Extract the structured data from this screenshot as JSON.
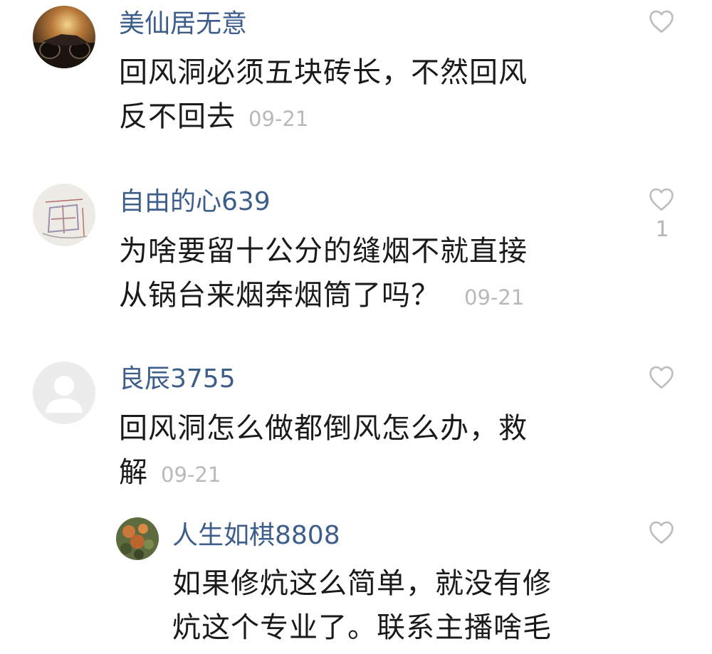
{
  "comments": [
    {
      "username": "美仙居无意",
      "lines": [
        "回风洞必须五块砖长，不然回风",
        "反不回去"
      ],
      "time": "09-21",
      "likes": ""
    },
    {
      "username": "自由的心639",
      "lines": [
        "为啥要留十公分的缝烟不就直接",
        "从锅台来烟奔烟筒了吗？"
      ],
      "time": "09-21",
      "likes": "1"
    },
    {
      "username": "良辰3755",
      "lines": [
        "回风洞怎么做都倒风怎么办，救",
        "解"
      ],
      "time": "09-21",
      "likes": ""
    }
  ],
  "reply": {
    "username": "人生如棋8808",
    "lines": [
      "如果修炕这么简单，就没有修",
      "炕这个专业了。联系主播啥毛"
    ]
  },
  "icons": {
    "like": "heart-outline-icon",
    "default_avatar": "person-placeholder-icon"
  },
  "colors": {
    "username": "#3d5d8a",
    "text": "#1a1a1a",
    "meta": "#b9b9b9",
    "icon": "#bdbdbd"
  }
}
